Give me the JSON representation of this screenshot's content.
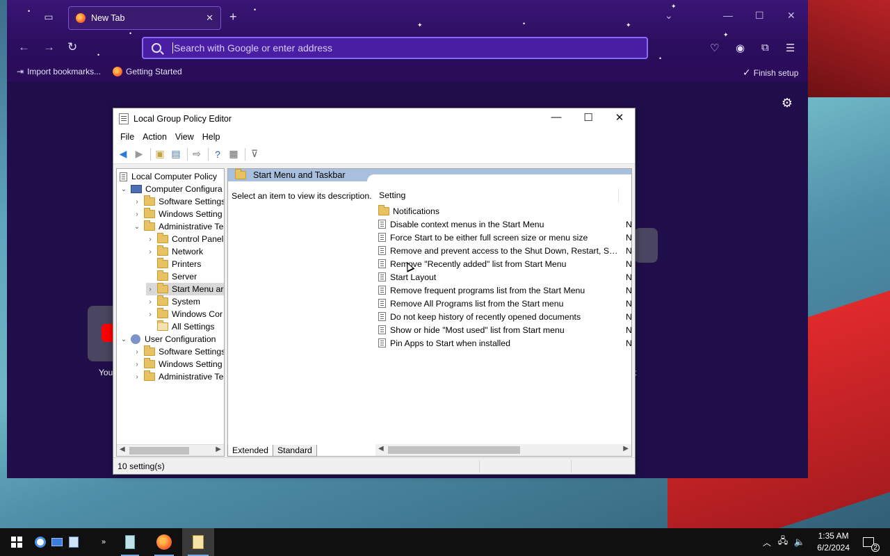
{
  "firefox": {
    "tab_title": "New Tab",
    "url_placeholder": "Search with Google or enter address",
    "bookmarks": {
      "import": "Import bookmarks...",
      "getting_started": "Getting Started",
      "finish_setup": "Finish setup"
    },
    "shortcut_labels": [
      "You",
      "t"
    ]
  },
  "gpedit": {
    "title": "Local Group Policy Editor",
    "menu": [
      "File",
      "Action",
      "View",
      "Help"
    ],
    "tree": {
      "root": "Local Computer Policy",
      "computer_config": "Computer Configura",
      "cc_software": "Software Settings",
      "cc_windows": "Windows Setting",
      "cc_admin": "Administrative Te",
      "control_panel": "Control Panel",
      "network": "Network",
      "printers": "Printers",
      "server": "Server",
      "start_menu": "Start Menu ar",
      "system": "System",
      "windows_components": "Windows Cor",
      "all_settings": "All Settings",
      "user_config": "User Configuration",
      "uc_software": "Software Settings",
      "uc_windows": "Windows Setting",
      "uc_admin": "Administrative Te"
    },
    "main": {
      "header": "Start Menu and Taskbar",
      "description": "Select an item to view its description.",
      "column_setting": "Setting",
      "folder_item": "Notifications",
      "items": [
        {
          "name": "Disable context menus in the Start Menu",
          "state": "N"
        },
        {
          "name": "Force Start to be either full screen size or menu size",
          "state": "N"
        },
        {
          "name": "Remove and prevent access to the Shut Down, Restart, Sleep...",
          "state": "N"
        },
        {
          "name": "Remove \"Recently added\" list from Start Menu",
          "state": "N"
        },
        {
          "name": "Start Layout",
          "state": "N"
        },
        {
          "name": "Remove frequent programs list from the Start Menu",
          "state": "N"
        },
        {
          "name": "Remove All Programs list from the Start menu",
          "state": "N"
        },
        {
          "name": "Do not keep history of recently opened documents",
          "state": "N"
        },
        {
          "name": "Show or hide \"Most used\" list from Start menu",
          "state": "N"
        },
        {
          "name": "Pin Apps to Start when installed",
          "state": "N"
        }
      ]
    },
    "bottom_tabs": {
      "extended": "Extended",
      "standard": "Standard"
    },
    "status": "10 setting(s)"
  },
  "taskbar": {
    "time": "1:35 AM",
    "date": "6/2/2024",
    "notification_count": "2"
  }
}
